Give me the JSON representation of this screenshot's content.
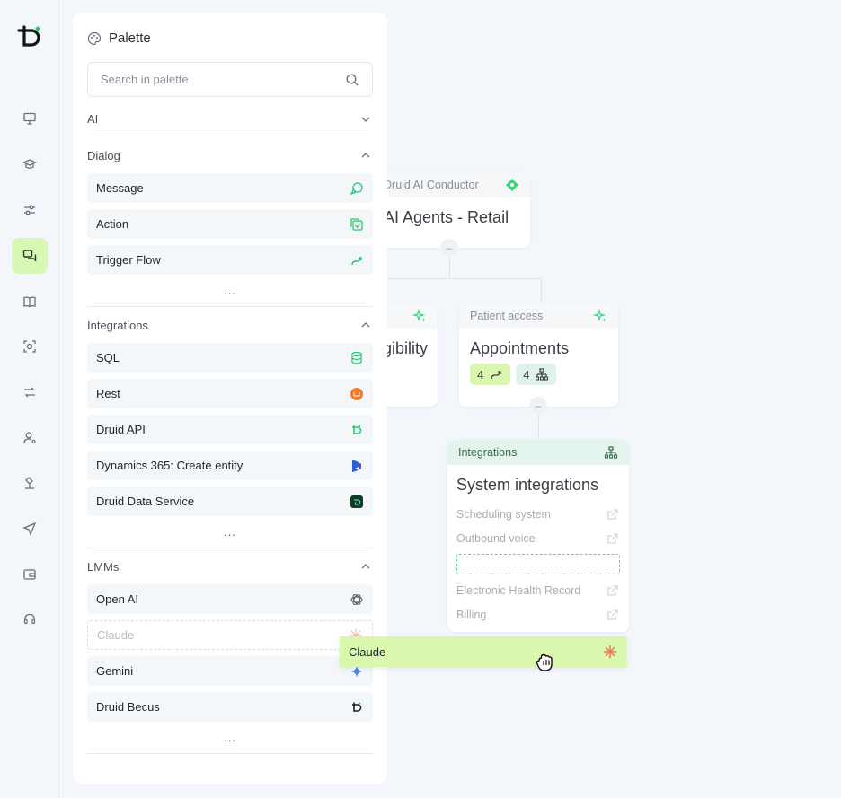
{
  "palette": {
    "title": "Palette",
    "search_placeholder": "Search in palette",
    "sections": {
      "ai": {
        "label": "AI"
      },
      "dialog": {
        "label": "Dialog",
        "items": [
          "Message",
          "Action",
          "Trigger Flow"
        ],
        "more": "..."
      },
      "integrations": {
        "label": "Integrations",
        "items": [
          "SQL",
          "Rest",
          "Druid API",
          "Dynamics 365: Create entity",
          "Druid Data Service"
        ],
        "more": "..."
      },
      "lmms": {
        "label": "LMMs",
        "items": [
          "Open AI",
          "Claude",
          "Gemini",
          "Druid Becus"
        ],
        "more": "..."
      }
    }
  },
  "canvas": {
    "conductor": {
      "label": "Druid AI Conductor",
      "title": "AI Agents - Retail"
    },
    "eligibility": {
      "title": "igibility"
    },
    "patient": {
      "label": "Patient access",
      "title": "Appointments",
      "flows_count": "4",
      "trees_count": "4"
    },
    "integrations": {
      "label": "Integrations",
      "title": "System integrations",
      "rows": [
        "Scheduling system",
        "Outbound voice",
        "Electronic Health Record",
        "Billing"
      ]
    },
    "dragging": {
      "label": "Claude"
    }
  },
  "colors": {
    "accent": "#28c76f",
    "active_rail": "#d7f7b5",
    "drag": "#d9f7ad",
    "claude": "#e8794f"
  }
}
